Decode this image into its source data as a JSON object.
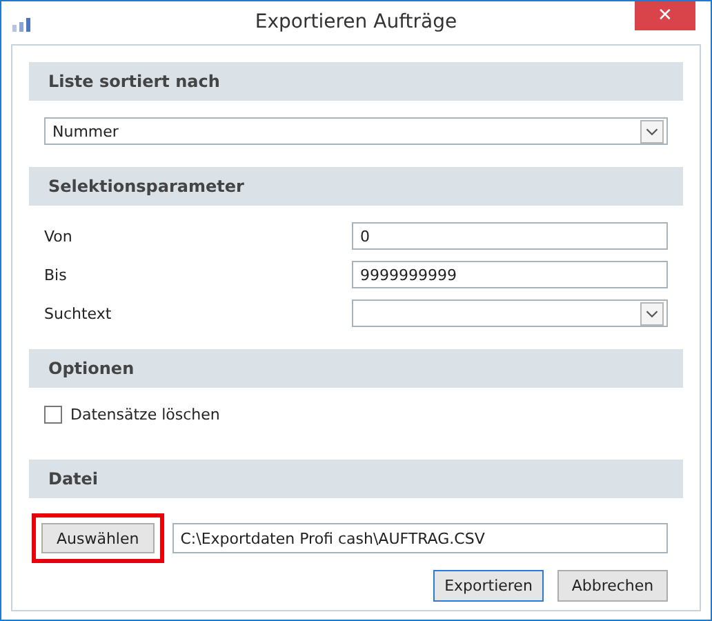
{
  "window": {
    "title": "Exportieren Aufträge",
    "close": "✕"
  },
  "sections": [
    {
      "kind": "combo",
      "title": "Liste sortiert nach",
      "value": "Nummer"
    },
    {
      "kind": "fields",
      "title": "Selektionsparameter",
      "fields": [
        {
          "kind": "text",
          "label": "Von",
          "value": "0"
        },
        {
          "kind": "text",
          "label": "Bis",
          "value": "9999999999"
        },
        {
          "kind": "combo",
          "label": "Suchtext"
        }
      ]
    },
    {
      "kind": "options",
      "title": "Optionen",
      "options": [
        {
          "label": "Datensätze löschen",
          "checked": false
        }
      ]
    },
    {
      "kind": "file",
      "title": "Datei",
      "button": "Auswählen",
      "highlighted": true,
      "path": "C:\\Exportdaten Profi cash\\AUFTRAG.CSV"
    }
  ],
  "buttons": [
    {
      "label": "Exportieren",
      "default": true
    },
    {
      "label": "Abbrechen",
      "default": false
    }
  ]
}
